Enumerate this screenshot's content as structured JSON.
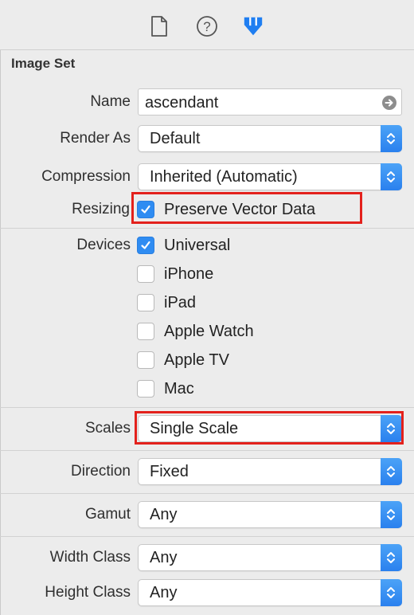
{
  "toolbar": {
    "icons": [
      "file-inspector-icon",
      "quick-help-icon",
      "attributes-inspector-icon"
    ]
  },
  "section": {
    "title": "Image Set"
  },
  "name": {
    "label": "Name",
    "value": "ascendant"
  },
  "render_as": {
    "label": "Render As",
    "value": "Default"
  },
  "compression": {
    "label": "Compression",
    "value": "Inherited (Automatic)"
  },
  "resizing": {
    "label": "Resizing",
    "option": "Preserve Vector Data",
    "checked": true
  },
  "devices": {
    "label": "Devices",
    "items": [
      {
        "label": "Universal",
        "checked": true
      },
      {
        "label": "iPhone",
        "checked": false
      },
      {
        "label": "iPad",
        "checked": false
      },
      {
        "label": "Apple Watch",
        "checked": false
      },
      {
        "label": "Apple TV",
        "checked": false
      },
      {
        "label": "Mac",
        "checked": false
      }
    ]
  },
  "scales": {
    "label": "Scales",
    "value": "Single Scale"
  },
  "direction": {
    "label": "Direction",
    "value": "Fixed"
  },
  "gamut": {
    "label": "Gamut",
    "value": "Any"
  },
  "width_class": {
    "label": "Width Class",
    "value": "Any"
  },
  "height_class": {
    "label": "Height Class",
    "value": "Any"
  },
  "colors": {
    "accent": "#2f8cf2",
    "highlight": "#e3211c"
  }
}
